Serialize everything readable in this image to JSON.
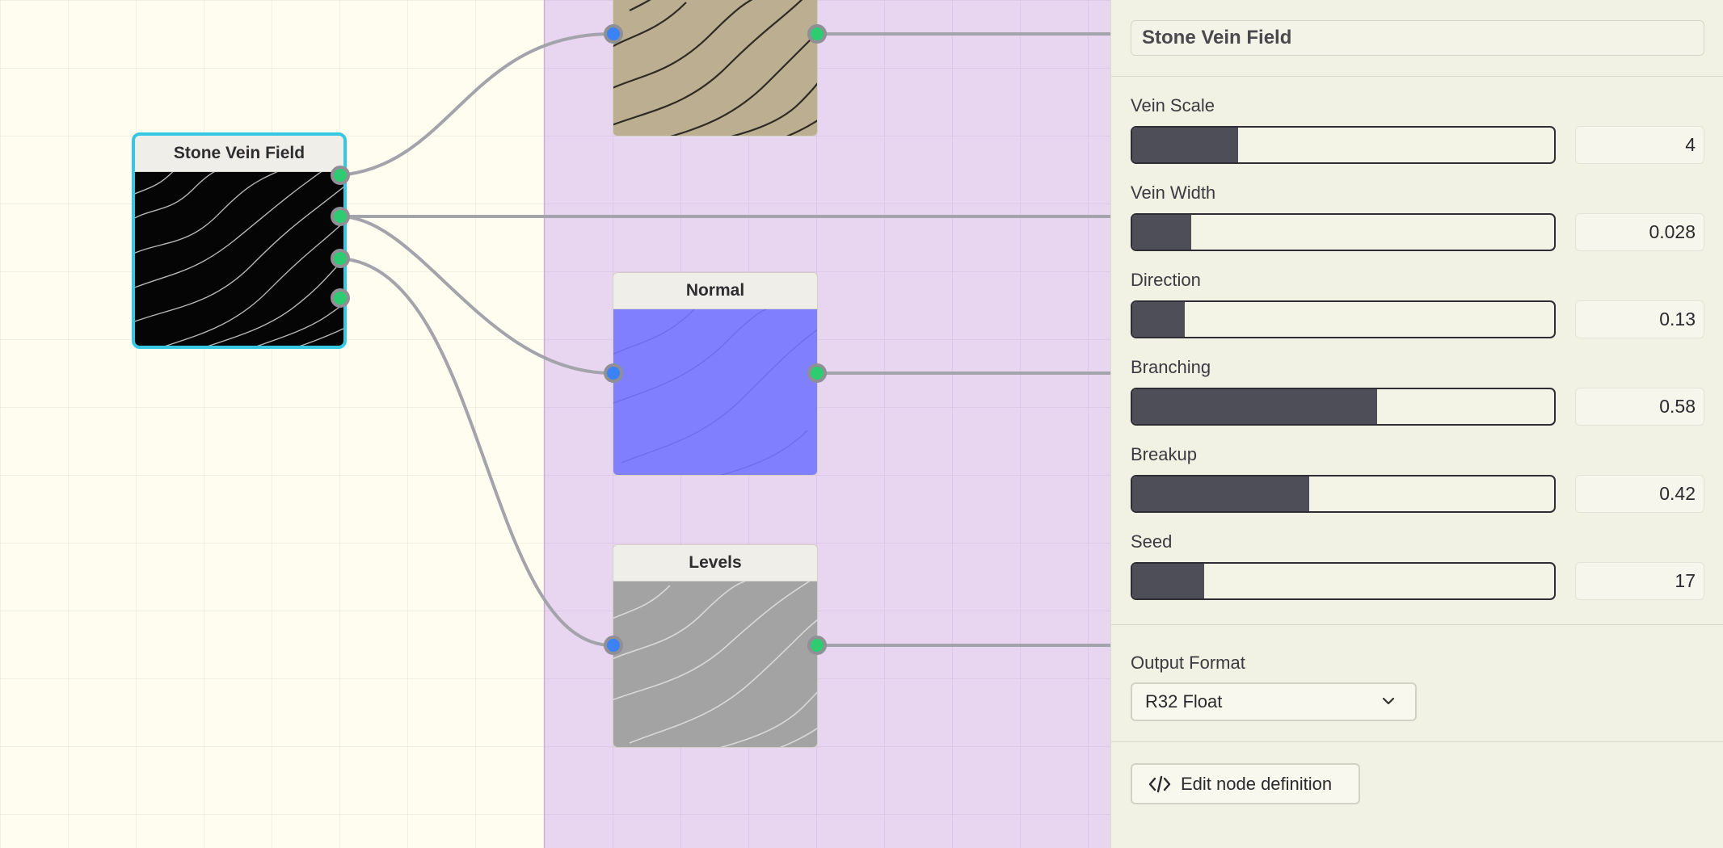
{
  "nodes": {
    "source": {
      "title": "Stone Vein Field"
    },
    "top_preview": {
      "title": ""
    },
    "normal": {
      "title": "Normal"
    },
    "levels": {
      "title": "Levels"
    }
  },
  "inspector": {
    "node_name": "Stone Vein Field",
    "params": [
      {
        "label": "Vein Scale",
        "value": "4",
        "fill_fraction": 0.25
      },
      {
        "label": "Vein Width",
        "value": "0.028",
        "fill_fraction": 0.14
      },
      {
        "label": "Direction",
        "value": "0.13",
        "fill_fraction": 0.125
      },
      {
        "label": "Branching",
        "value": "0.58",
        "fill_fraction": 0.58
      },
      {
        "label": "Breakup",
        "value": "0.42",
        "fill_fraction": 0.42
      },
      {
        "label": "Seed",
        "value": "17",
        "fill_fraction": 0.17
      }
    ],
    "output_format": {
      "label": "Output Format",
      "selected": "R32 Float"
    },
    "edit_button": {
      "label": "Edit node definition",
      "icon": "code-icon"
    }
  },
  "colors": {
    "canvas_bg": "#fefdef",
    "frame_bg": "#e8d5ef",
    "selection": "#35c7e3",
    "input_port": "#3b82f6",
    "output_port": "#2ecc71",
    "wire": "#a3a3ab",
    "normal_map": "#8080ff"
  }
}
